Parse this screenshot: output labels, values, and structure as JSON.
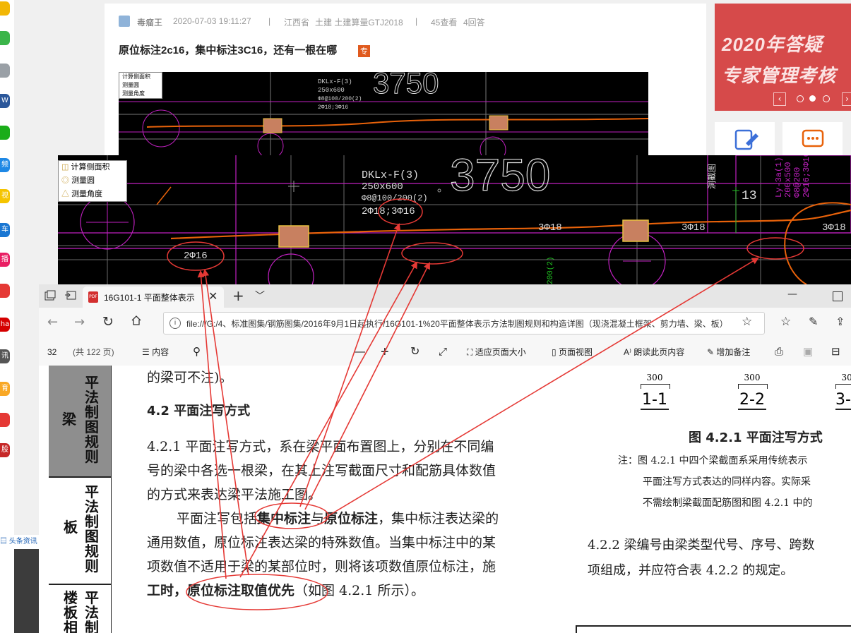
{
  "taskbar": {
    "icons": [
      {
        "name": "star-app-icon",
        "label": "",
        "color": "#f2b705"
      },
      {
        "name": "chat-app-icon",
        "label": "",
        "color": "#3bb54a"
      },
      {
        "name": "doc-app-icon",
        "label": "",
        "color": "#9aa0a6"
      },
      {
        "name": "word-app-icon",
        "label": "W",
        "color": "#2b579a"
      },
      {
        "name": "green-app-icon",
        "label": "",
        "color": "#1aad19"
      },
      {
        "name": "video-app-icon",
        "label": "频",
        "color": "#1e88e5"
      },
      {
        "name": "yellow-app-icon",
        "label": "视",
        "color": "#f5c400"
      },
      {
        "name": "car-app-icon",
        "label": "车",
        "color": "#1976d2"
      },
      {
        "name": "broadcast-app-icon",
        "label": "播",
        "color": "#e91e63"
      },
      {
        "name": "game-app-icon",
        "label": "",
        "color": "#e53935"
      },
      {
        "name": "brand-app-icon",
        "label": "ha",
        "color": "#d50000"
      },
      {
        "name": "news-app-icon",
        "label": "讯",
        "color": "#555555"
      },
      {
        "name": "edu-app-icon",
        "label": "育",
        "color": "#f9a825"
      },
      {
        "name": "circle-app-icon",
        "label": "",
        "color": "#e53935"
      },
      {
        "name": "stock-app-icon",
        "label": "股",
        "color": "#c62828"
      }
    ],
    "footer_label": "头条资讯"
  },
  "post": {
    "author": "毒瘤王",
    "date": "2020-07-03 19:11:27",
    "separator": "|",
    "region": "江西省",
    "tags": "土建 土建算量GTJ2018",
    "views": "45查看",
    "answers": "4回答",
    "title": "原位标注2c16，集中标注3C16，还有一根在哪",
    "badge": "专"
  },
  "banner": {
    "line1": "2020年答疑",
    "line2": "专家管理考核"
  },
  "cad_palette": {
    "items": [
      "计算侧面积",
      "测量圆",
      "测量角度"
    ]
  },
  "cad": {
    "beam_id": "DKLx-F(3)",
    "section": "250x600",
    "stirrup": "Φ8@100/200(2)",
    "rebar": "2Φ18;3Φ16",
    "dimension": "3750",
    "left_label": "2Φ16",
    "right_labels": [
      "3Φ18",
      "3Φ18",
      "3Φ18"
    ],
    "vertical_label": "Ly-3a(1)",
    "vertical_label2": "200x500",
    "vertical_label3": "Φ8@200",
    "vertical_label4": "2Φ16;3Φ16",
    "cjc_label": "洞截图",
    "side_number": "13",
    "bottom_label": "200(2)"
  },
  "browser": {
    "tab_title": "16G101-1 平面整体表示",
    "url": "file:///G:/4、标准图集/钢筋图集/2016年9月1日起执行/16G101-1%20平面整体表示方法制图规则和构造详图（现浇混凝土框架、剪力墙、梁、板）.pdf",
    "page_current": "32",
    "page_total": "(共 122 页)",
    "toolbar": {
      "contents": "内容",
      "fit_page": "适应页面大小",
      "page_view": "页面视图",
      "read_aloud": "朗读此页内容",
      "add_note": "增加备注"
    }
  },
  "doc": {
    "side_tabs": [
      "平法制图规则",
      "梁",
      "平法制图规则",
      "板",
      "平法制",
      "楼板相"
    ],
    "line0": "的梁可不注)。",
    "heading": "4.2  平面注写方式",
    "p1_line1": "4.2.1  平面注写方式，系在梁平面布置图上，分别在不同编",
    "p1_line2": "号的梁中各选一根梁，在其上注写截面尺寸和配筋具体数值",
    "p1_line3": "的方式来表达梁平法施工图。",
    "p2_line1_pre": "平面注写包括",
    "p2_line1_b1": "集中标注",
    "p2_line1_mid": "与",
    "p2_line1_b2": "原位标注",
    "p2_line1_post": "，集中标注表达梁的",
    "p2_line2": "通用数值，原位标注表达梁的特殊数值。当集中标注中的某",
    "p2_line3": "项数值不适用于梁的某部位时，则将该项数值原位标注，施",
    "p2_line4_b1": "工时，原位标注取值优先",
    "p2_line4_post": "（如图 4.2.1 所示）。",
    "dims": [
      "300",
      "300",
      "300"
    ],
    "section_labels": [
      "1-1",
      "2-2",
      "3-"
    ],
    "fig_title": "图 4.2.1  平面注写方式",
    "note1": "注：图 4.2.1 中四个梁截面系采用传统表示",
    "note2": "平面注写方式表达的同样内容。实际采",
    "note3": "不需绘制梁截面配筋图和图 4.2.1 中的",
    "p3_line1": "4.2.2  梁编号由梁类型代号、序号、跨数",
    "p3_line2": "项组成，并应符合表 4.2.2 的规定。"
  },
  "colors": {
    "annotation_red": "#e53935",
    "cad_orange": "#e8620a",
    "cad_magenta": "#c020c0",
    "banner_red": "#d64a4a"
  }
}
